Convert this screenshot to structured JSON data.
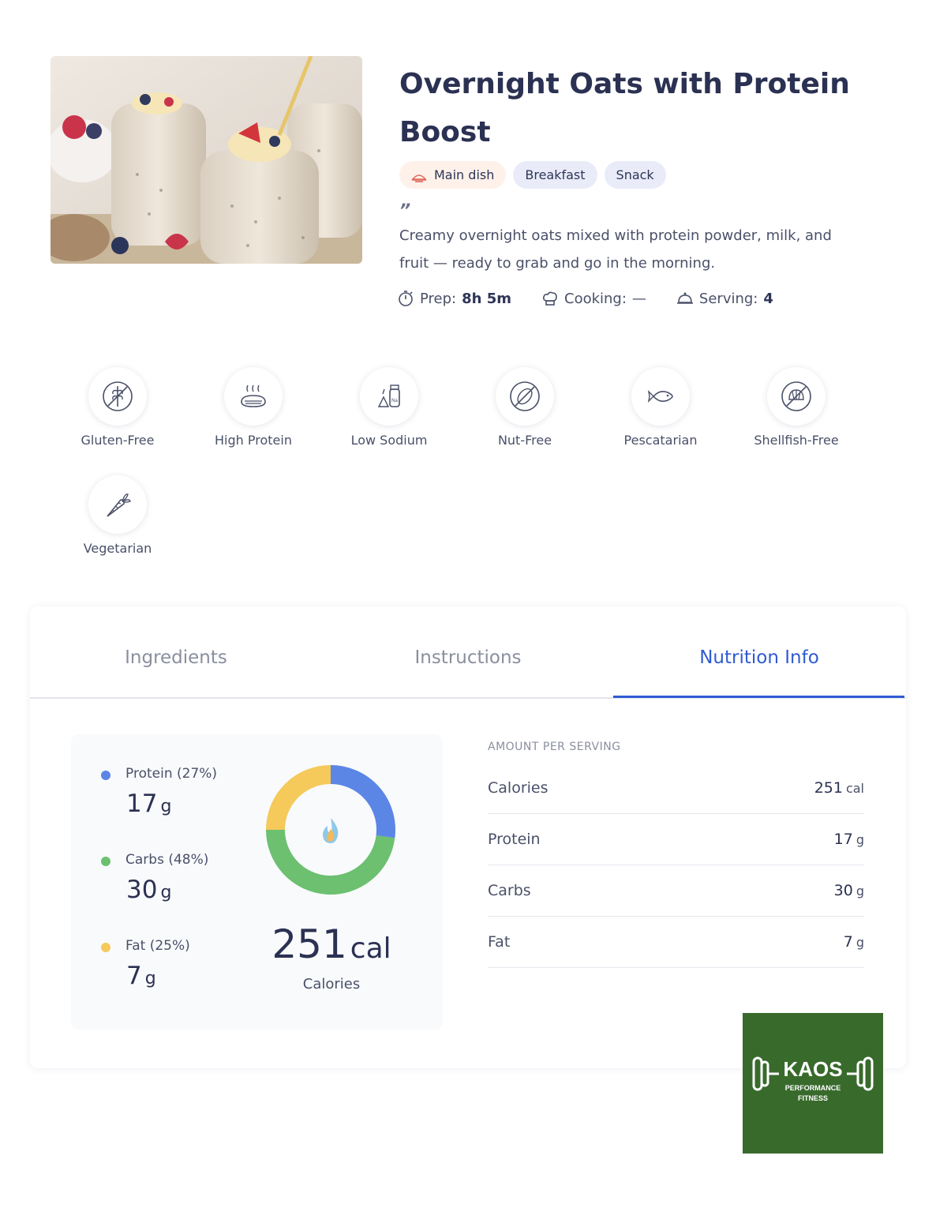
{
  "recipe": {
    "title": "Overnight Oats with Protein Boost",
    "tags": [
      "Main dish",
      "Breakfast",
      "Snack"
    ],
    "quote_mark": "”",
    "description": "Creamy overnight oats mixed with protein powder, milk, and fruit — ready to grab and go in the morning.",
    "meta": {
      "prep_label": "Prep:",
      "prep_value": "8h 5m",
      "cooking_label": "Cooking:",
      "cooking_value": "—",
      "serving_label": "Serving:",
      "serving_value": "4"
    }
  },
  "diet_badges": [
    {
      "label": "Gluten-Free",
      "icon": "gluten-free-icon"
    },
    {
      "label": "High Protein",
      "icon": "high-protein-icon"
    },
    {
      "label": "Low Sodium",
      "icon": "low-sodium-icon"
    },
    {
      "label": "Nut-Free",
      "icon": "nut-free-icon"
    },
    {
      "label": "Pescatarian",
      "icon": "fish-icon"
    },
    {
      "label": "Shellfish-Free",
      "icon": "shellfish-free-icon"
    },
    {
      "label": "Vegetarian",
      "icon": "carrot-icon"
    }
  ],
  "tabs": [
    {
      "label": "Ingredients",
      "active": false
    },
    {
      "label": "Instructions",
      "active": false
    },
    {
      "label": "Nutrition Info",
      "active": true
    }
  ],
  "macros": [
    {
      "name": "Protein",
      "percent": "(27%)",
      "value": "17",
      "unit": "g",
      "color": "#5b86e5",
      "share": 27
    },
    {
      "name": "Carbs",
      "percent": "(48%)",
      "value": "30",
      "unit": "g",
      "color": "#6cc070",
      "share": 48
    },
    {
      "name": "Fat",
      "percent": "(25%)",
      "value": "7",
      "unit": "g",
      "color": "#f5c95a",
      "share": 25
    }
  ],
  "calories": {
    "value": "251",
    "unit": "cal",
    "label": "Calories"
  },
  "nutrition_table": {
    "title": "AMOUNT PER SERVING",
    "rows": [
      {
        "label": "Calories",
        "value": "251",
        "unit": "cal"
      },
      {
        "label": "Protein",
        "value": "17",
        "unit": "g"
      },
      {
        "label": "Carbs",
        "value": "30",
        "unit": "g"
      },
      {
        "label": "Fat",
        "value": "7",
        "unit": "g"
      }
    ]
  },
  "logo": {
    "name": "KAOS",
    "line1": "PERFORMANCE",
    "line2": "FITNESS",
    "bg_color": "#386a2c"
  }
}
